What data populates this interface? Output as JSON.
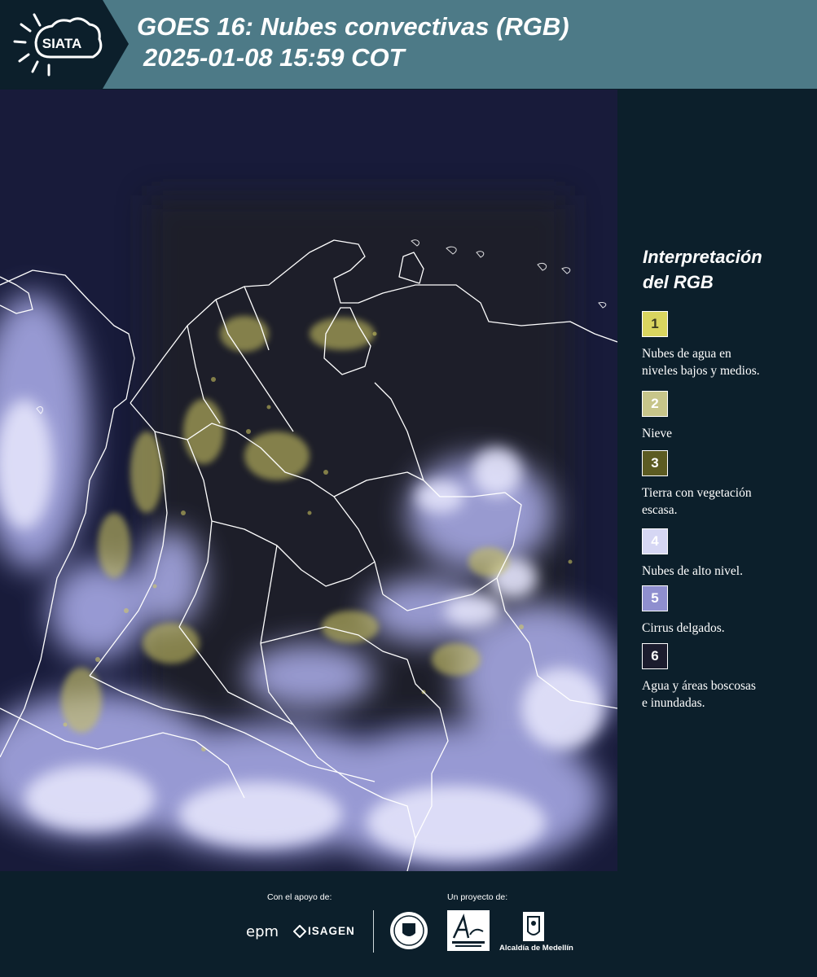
{
  "header": {
    "logo_text": "SIATA",
    "title_line1": "GOES 16: Nubes convectivas (RGB)",
    "title_line2": "2025-01-08 15:59 COT"
  },
  "legend": {
    "title_line1": "Interpretación",
    "title_line2": "del RGB",
    "items": [
      {
        "number": "1",
        "color": "#d9d55f",
        "text_color": "#3a3a20",
        "line1": "Nubes de agua en",
        "line2": "niveles bajos y medios."
      },
      {
        "number": "2",
        "color": "#c7c58a",
        "text_color": "#ffffff",
        "line1": "Nieve",
        "line2": ""
      },
      {
        "number": "3",
        "color": "#5c5b22",
        "text_color": "#ffffff",
        "line1": "Tierra con vegetación",
        "line2": "escasa."
      },
      {
        "number": "4",
        "color": "#d6d7f4",
        "text_color": "#ffffff",
        "line1": "Nubes de alto nivel.",
        "line2": ""
      },
      {
        "number": "5",
        "color": "#8f8fcf",
        "text_color": "#ffffff",
        "line1": "Cirrus delgados.",
        "line2": ""
      },
      {
        "number": "6",
        "color": "#1c1c2e",
        "text_color": "#ffffff",
        "line1": "Agua y áreas boscosas",
        "line2": "e inundadas."
      }
    ]
  },
  "footer": {
    "support_label": "Con el apoyo de:",
    "project_label": "Un proyecto de:",
    "epm": "epm",
    "isagen": "ISAGEN",
    "alcaldia": "Alcaldía de Medellín"
  },
  "colors": {
    "header_bg": "#4d7a87",
    "logo_bg": "#0c1f2b",
    "page_bg": "#0c1f2b",
    "map_dark": "#181b3a",
    "cloud_high": "#b7b8f0",
    "cloud_low": "#c9c262"
  }
}
